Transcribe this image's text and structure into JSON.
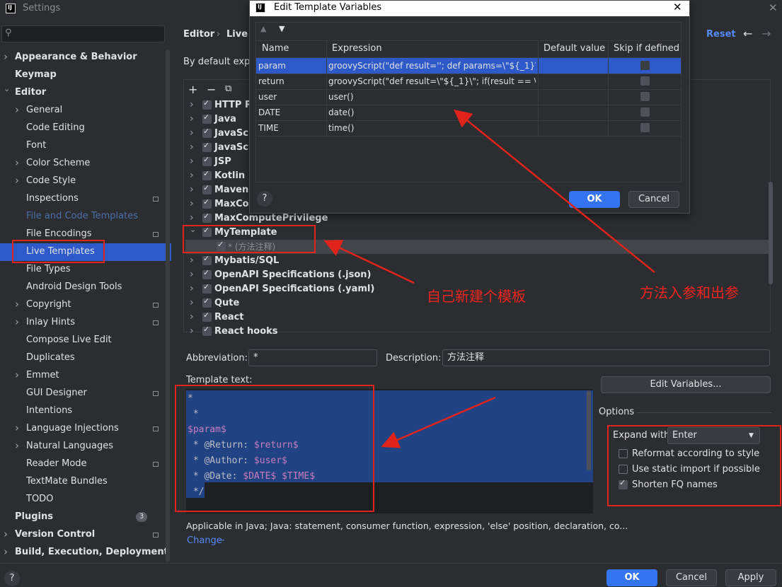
{
  "window": {
    "title": "Settings"
  },
  "sidebar": {
    "search_placeholder": "",
    "items": [
      {
        "label": "Appearance & Behavior",
        "bold": true,
        "chevron": true
      },
      {
        "label": "Keymap",
        "bold": true
      },
      {
        "label": "Editor",
        "bold": true,
        "expanded": true
      },
      {
        "label": "General",
        "chevron": true
      },
      {
        "label": "Code Editing"
      },
      {
        "label": "Font"
      },
      {
        "label": "Color Scheme",
        "chevron": true
      },
      {
        "label": "Code Style",
        "chevron": true
      },
      {
        "label": "Inspections",
        "gear": true
      },
      {
        "label": "File and Code Templates",
        "dim": true
      },
      {
        "label": "File Encodings",
        "gear": true
      },
      {
        "label": "Live Templates",
        "selected": true
      },
      {
        "label": "File Types"
      },
      {
        "label": "Android Design Tools"
      },
      {
        "label": "Copyright",
        "chevron": true,
        "gear": true
      },
      {
        "label": "Inlay Hints",
        "chevron": true,
        "gear": true
      },
      {
        "label": "Compose Live Edit"
      },
      {
        "label": "Duplicates"
      },
      {
        "label": "Emmet",
        "chevron": true
      },
      {
        "label": "GUI Designer",
        "gear": true
      },
      {
        "label": "Intentions"
      },
      {
        "label": "Language Injections",
        "chevron": true,
        "gear": true
      },
      {
        "label": "Natural Languages",
        "chevron": true
      },
      {
        "label": "Reader Mode",
        "gear": true
      },
      {
        "label": "TextMate Bundles"
      },
      {
        "label": "TODO"
      },
      {
        "label": "Plugins",
        "bold": true,
        "badge": "3"
      },
      {
        "label": "Version Control",
        "bold": true,
        "chevron": true,
        "gear": true
      },
      {
        "label": "Build, Execution, Deployment",
        "bold": true,
        "chevron": true
      }
    ]
  },
  "main": {
    "breadcrumb_editor": "Editor",
    "breadcrumb_sep": "›",
    "breadcrumb_live": "Live",
    "reset": "Reset",
    "intro": "By default expa",
    "toolbar": {
      "add": "+",
      "remove": "−",
      "copy": "⧉"
    },
    "groups": [
      {
        "label": "HTTP R"
      },
      {
        "label": "Java"
      },
      {
        "label": "JavaScr"
      },
      {
        "label": "JavaScr"
      },
      {
        "label": "JSP"
      },
      {
        "label": "Kotlin"
      },
      {
        "label": "Maven"
      },
      {
        "label": "MaxCo"
      },
      {
        "label": "MaxComputePrivilege"
      },
      {
        "label": "MyTemplate",
        "expanded": true
      },
      {
        "label": "* (方法注释)",
        "child": true
      },
      {
        "label": "Mybatis/SQL"
      },
      {
        "label": "OpenAPI Specifications (.json)"
      },
      {
        "label": "OpenAPI Specifications (.yaml)"
      },
      {
        "label": "Qute"
      },
      {
        "label": "React"
      },
      {
        "label": "React hooks"
      }
    ],
    "abbreviation_label": "Abbreviation:",
    "abbreviation_value": "*",
    "description_label": "Description:",
    "description_value": "方法注释",
    "template_text_label": "Template text:",
    "template_lines": [
      [
        {
          "t": "*"
        }
      ],
      [
        {
          "t": " *"
        }
      ],
      [
        {
          "t": "$param$",
          "v": true
        }
      ],
      [
        {
          "t": " * @Return: "
        },
        {
          "t": "$return$",
          "v": true
        }
      ],
      [
        {
          "t": " * @Author: "
        },
        {
          "t": "$user$",
          "v": true
        }
      ],
      [
        {
          "t": " * @Date: "
        },
        {
          "t": "$DATE$ $TIME$",
          "v": true
        }
      ],
      [
        {
          "t": " */"
        }
      ]
    ],
    "edit_variables": "Edit Variables...",
    "options_label": "Options",
    "expand_with_label": "Expand with",
    "expand_with_value": "Enter",
    "opt_reformat": "Reformat according to style",
    "opt_static": "Use static import if possible",
    "opt_shorten": "Shorten FQ names",
    "applicable": "Applicable in Java; Java: statement, consumer function, expression, 'else' position, declaration, co...",
    "change": "Change"
  },
  "dialog": {
    "title": "Edit Template Variables",
    "columns": [
      "Name",
      "Expression",
      "Default value",
      "Skip if defined"
    ],
    "rows": [
      {
        "name": "param",
        "expr": "groovyScript(\"def result=''; def params=\\\"${_1}\\\"...",
        "def": "",
        "skip": false,
        "selected": true
      },
      {
        "name": "return",
        "expr": "groovyScript(\"def result=\\\"${_1}\\\"; if(result == \\\"...",
        "def": "",
        "skip": false
      },
      {
        "name": "user",
        "expr": "user()",
        "def": "",
        "skip": false
      },
      {
        "name": "DATE",
        "expr": "date()",
        "def": "",
        "skip": false
      },
      {
        "name": "TIME",
        "expr": "time()",
        "def": "",
        "skip": false
      }
    ],
    "ok": "OK",
    "cancel": "Cancel"
  },
  "annotations": {
    "new_template": "自己新建个模板",
    "params": "方法入参和出参",
    "color": "#e0231b"
  },
  "footer": {
    "ok": "OK",
    "cancel": "Cancel",
    "apply": "Apply",
    "help": "?"
  }
}
